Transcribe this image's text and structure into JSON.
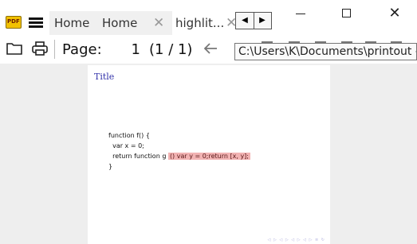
{
  "app": {
    "icon_text": "PDF"
  },
  "tabs": [
    {
      "label": "Home",
      "secondary_label": "Home",
      "close": "✕"
    },
    {
      "label": "highlit...",
      "close": "✕"
    }
  ],
  "tab_scroll": {
    "left": "◀",
    "right": "▶"
  },
  "window_controls": {
    "close": "✕"
  },
  "toolbar": {
    "page_label": "Page:",
    "page_value": "1",
    "page_total": "(1 / 1)"
  },
  "tooltip": {
    "text": "C:\\Users\\K\\Documents\\printout - C"
  },
  "document": {
    "title": "Title",
    "code_lines": [
      "function f() {",
      "  var x = 0;",
      "  return function g",
      "}"
    ],
    "highlight": "() var y = 0;return [x, y];",
    "nav_symbols": "◁ ▷ ◁ ▷ ◁ ▷ ◁ ▷ ≡ ↻"
  },
  "colors": {
    "title": "#3333aa",
    "highlight": "#f2b3b3",
    "app_icon": "#f2c100",
    "viewer_bg": "#eeeeee"
  }
}
